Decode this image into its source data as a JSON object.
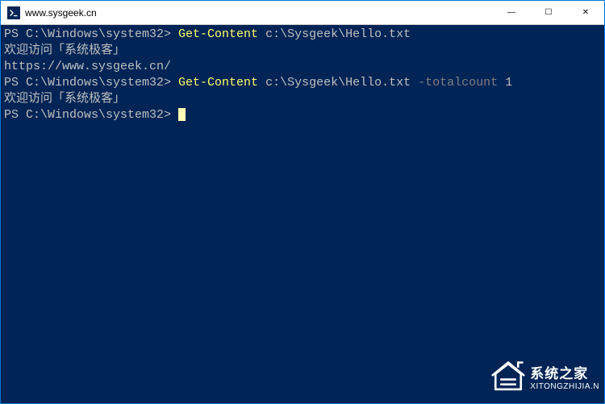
{
  "window": {
    "title": "www.sysgeek.cn"
  },
  "terminal": {
    "lines": [
      {
        "prompt": "PS C:\\Windows\\system32> ",
        "cmdlet": "Get-Content",
        "space1": " ",
        "arg": "c:\\Sysgeek\\Hello.txt"
      },
      {
        "output": "欢迎访问「系统极客」"
      },
      {
        "output": ""
      },
      {
        "output": "https://www.sysgeek.cn/"
      },
      {
        "prompt": "PS C:\\Windows\\system32> ",
        "cmdlet": "Get-Content",
        "space1": " ",
        "arg": "c:\\Sysgeek\\Hello.txt",
        "space2": " ",
        "param": "-totalcount",
        "space3": " ",
        "arg2": "1"
      },
      {
        "output": "欢迎访问「系统极客」"
      },
      {
        "prompt": "PS C:\\Windows\\system32> ",
        "cursor": true
      }
    ]
  },
  "watermark": {
    "name": "系统之家",
    "url": "XITONGZHIJIA.N"
  },
  "controls": {
    "minimize": "—",
    "maximize": "☐",
    "close": "✕"
  }
}
